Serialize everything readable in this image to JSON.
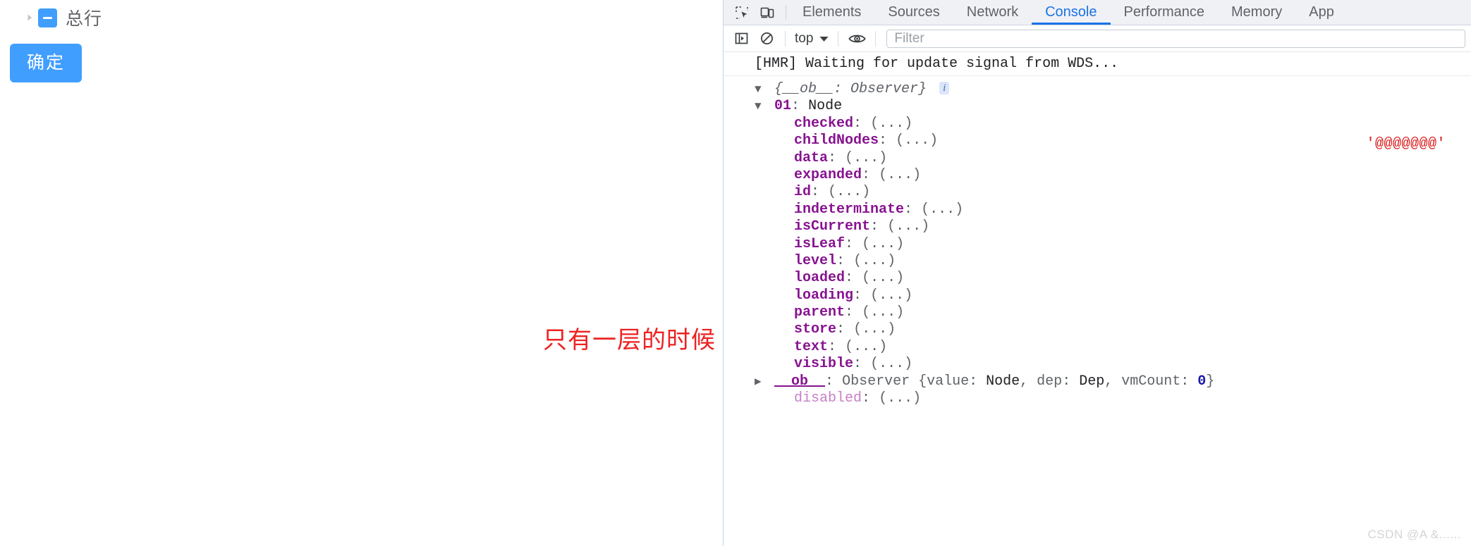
{
  "page": {
    "tree": {
      "expand_arrow_icon": "chevron-right-icon",
      "checkbox_state_icon": "indeterminate-checkbox-icon",
      "label": "总行"
    },
    "confirm_button_label": "确定",
    "annotation_text": "只有一层的时候",
    "accent_color": "#409eff",
    "annotation_color": "#ee2222"
  },
  "devtools": {
    "toolbar_icons": [
      {
        "name": "inspect-element-icon",
        "title": "Inspect"
      },
      {
        "name": "device-toolbar-icon",
        "title": "Toggle device toolbar"
      }
    ],
    "tabs": [
      {
        "label": "Elements",
        "active": false
      },
      {
        "label": "Sources",
        "active": false
      },
      {
        "label": "Network",
        "active": false
      },
      {
        "label": "Console",
        "active": true
      },
      {
        "label": "Performance",
        "active": false
      },
      {
        "label": "Memory",
        "active": false
      },
      {
        "label": "App",
        "active": false
      }
    ],
    "active_tab": "Console",
    "active_tab_color": "#1a73e8",
    "console_toolbar": {
      "sidebar_toggle_icon": "console-sidebar-icon",
      "clear_console_icon": "clear-console-icon",
      "context_selector_value": "top",
      "context_selector_caret_icon": "chevron-down-icon",
      "live_expression_icon": "eye-icon",
      "filter_placeholder": "Filter",
      "filter_value": ""
    },
    "console": {
      "messages": [
        {
          "type": "log",
          "text": "[HMR] Waiting for update signal from WDS..."
        }
      ],
      "object_root": {
        "disclosure": "open",
        "preview": "{__ob__: Observer}",
        "info_badge": "i"
      },
      "object_index_entry": {
        "disclosure": "open",
        "index": "01",
        "separator": ":",
        "class_name": "Node"
      },
      "properties": [
        {
          "key": "checked",
          "value": "(...)",
          "dim": false
        },
        {
          "key": "childNodes",
          "value": "(...)",
          "dim": false
        },
        {
          "key": "data",
          "value": "(...)",
          "dim": false
        },
        {
          "key": "expanded",
          "value": "(...)",
          "dim": false
        },
        {
          "key": "id",
          "value": "(...)",
          "dim": false
        },
        {
          "key": "indeterminate",
          "value": "(...)",
          "dim": false
        },
        {
          "key": "isCurrent",
          "value": "(...)",
          "dim": false
        },
        {
          "key": "isLeaf",
          "value": "(...)",
          "dim": false
        },
        {
          "key": "level",
          "value": "(...)",
          "dim": false
        },
        {
          "key": "loaded",
          "value": "(...)",
          "dim": false
        },
        {
          "key": "loading",
          "value": "(...)",
          "dim": false
        },
        {
          "key": "parent",
          "value": "(...)",
          "dim": false
        },
        {
          "key": "store",
          "value": "(...)",
          "dim": false
        },
        {
          "key": "text",
          "value": "(...)",
          "dim": false
        },
        {
          "key": "visible",
          "value": "(...)",
          "dim": false
        }
      ],
      "observer_row": {
        "disclosure": "closed",
        "key": "__ob__",
        "class_name": "Observer",
        "preview_open": "{",
        "field1_key": "value",
        "field1_value": "Node",
        "field2_key": "dep",
        "field2_value": "Dep",
        "field3_key": "vmCount",
        "field3_value": "0",
        "preview_close": "}"
      },
      "trailing_properties": [
        {
          "key": "disabled",
          "value": "(...)",
          "dim": true
        }
      ],
      "right_string_output": "'@@@@@@@'",
      "right_string_color": "#d81414"
    }
  },
  "watermark": "CSDN @A &......"
}
